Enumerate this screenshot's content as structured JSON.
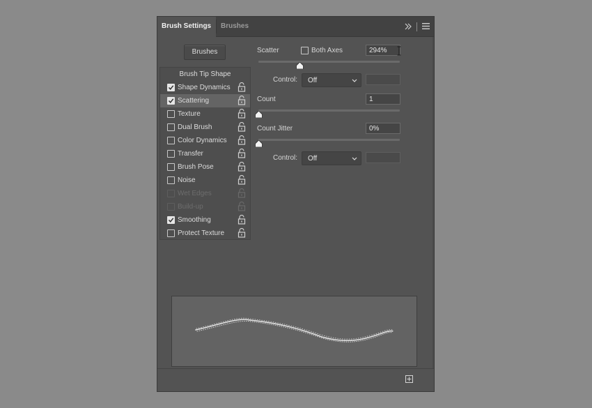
{
  "tabs": [
    {
      "label": "Brush Settings",
      "active": true
    },
    {
      "label": "Brushes",
      "active": false
    }
  ],
  "icons": {
    "collapse": "double-chevron-right-icon",
    "menu": "hamburger-menu-icon",
    "lock": "padlock-open-icon",
    "new": "create-new-brush-icon"
  },
  "brushes_button": "Brushes",
  "brush_tip_shape": "Brush Tip Shape",
  "options": [
    {
      "label": "Shape Dynamics",
      "checked": true,
      "enabled": true,
      "selected": false
    },
    {
      "label": "Scattering",
      "checked": true,
      "enabled": true,
      "selected": true
    },
    {
      "label": "Texture",
      "checked": false,
      "enabled": true,
      "selected": false
    },
    {
      "label": "Dual Brush",
      "checked": false,
      "enabled": true,
      "selected": false
    },
    {
      "label": "Color Dynamics",
      "checked": false,
      "enabled": true,
      "selected": false
    },
    {
      "label": "Transfer",
      "checked": false,
      "enabled": true,
      "selected": false
    },
    {
      "label": "Brush Pose",
      "checked": false,
      "enabled": true,
      "selected": false
    },
    {
      "label": "Noise",
      "checked": false,
      "enabled": true,
      "selected": false
    },
    {
      "label": "Wet Edges",
      "checked": false,
      "enabled": false,
      "selected": false
    },
    {
      "label": "Build-up",
      "checked": false,
      "enabled": false,
      "selected": false
    },
    {
      "label": "Smoothing",
      "checked": true,
      "enabled": true,
      "selected": false
    },
    {
      "label": "Protect Texture",
      "checked": false,
      "enabled": true,
      "selected": false
    }
  ],
  "scatter": {
    "label": "Scatter",
    "both_axes_label": "Both Axes",
    "both_axes_checked": false,
    "value": "294%",
    "slider_fraction": 0.294,
    "control_label": "Control:",
    "control_value": "Off",
    "control_extra": ""
  },
  "count": {
    "label": "Count",
    "value": "1",
    "slider_fraction": 0.0
  },
  "count_jitter": {
    "label": "Count Jitter",
    "value": "0%",
    "slider_fraction": 0.0,
    "control_label": "Control:",
    "control_value": "Off",
    "control_extra": ""
  },
  "colors": {
    "panel": "#535353",
    "tabbar": "#424242",
    "page": "#8a8a8a"
  }
}
